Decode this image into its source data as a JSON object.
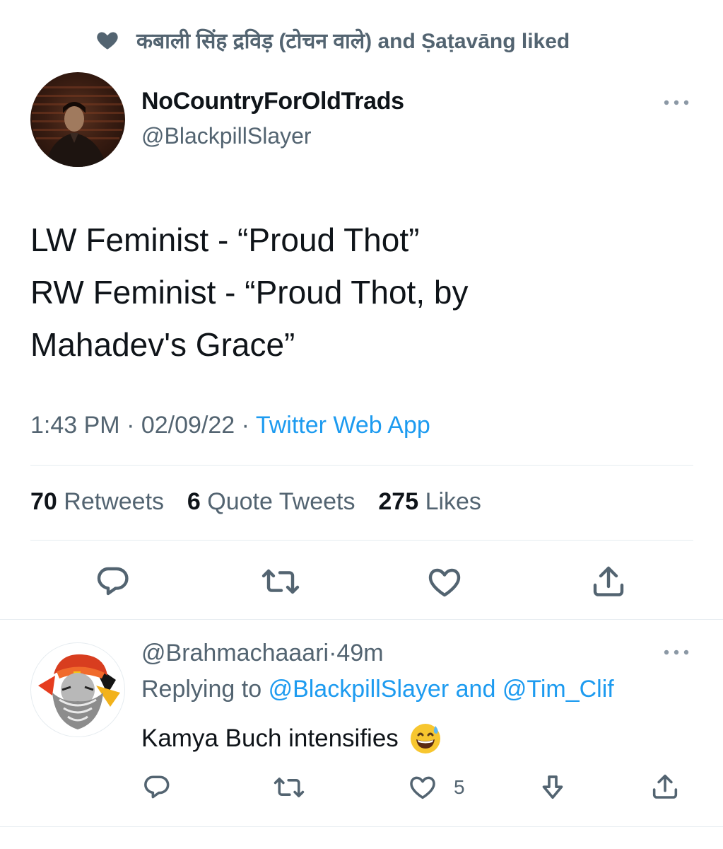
{
  "social_context": {
    "text": "कबाली सिंह द्रविड़ (टोचन वाले) and Ṣaṭavāng liked"
  },
  "main_tweet": {
    "display_name": "NoCountryForOldTrads",
    "handle": "@BlackpillSlayer",
    "text_lines": [
      "LW Feminist - “Proud Thot”",
      "RW Feminist - “Proud Thot, by",
      "Mahadev's Grace”"
    ],
    "time": "1:43 PM",
    "date": "02/09/22",
    "separator": "·",
    "source": "Twitter Web App",
    "stats": {
      "retweets_count": "70",
      "retweets_label": "Retweets",
      "quotes_count": "6",
      "quotes_label": "Quote Tweets",
      "likes_count": "275",
      "likes_label": "Likes"
    }
  },
  "reply": {
    "handle": "@Brahmachaaari",
    "separator": "·",
    "age": "49m",
    "replying_prefix": "Replying to",
    "replying_to_1": "@BlackpillSlayer",
    "replying_and": "and",
    "replying_to_2": "@Tim_Clif",
    "text": "Kamya Buch intensifies",
    "emoji": "😅",
    "like_count": "5"
  },
  "colors": {
    "accent": "#1d9bf0",
    "muted": "#536471",
    "text": "#0f1419",
    "divider": "#e6ecf0"
  }
}
